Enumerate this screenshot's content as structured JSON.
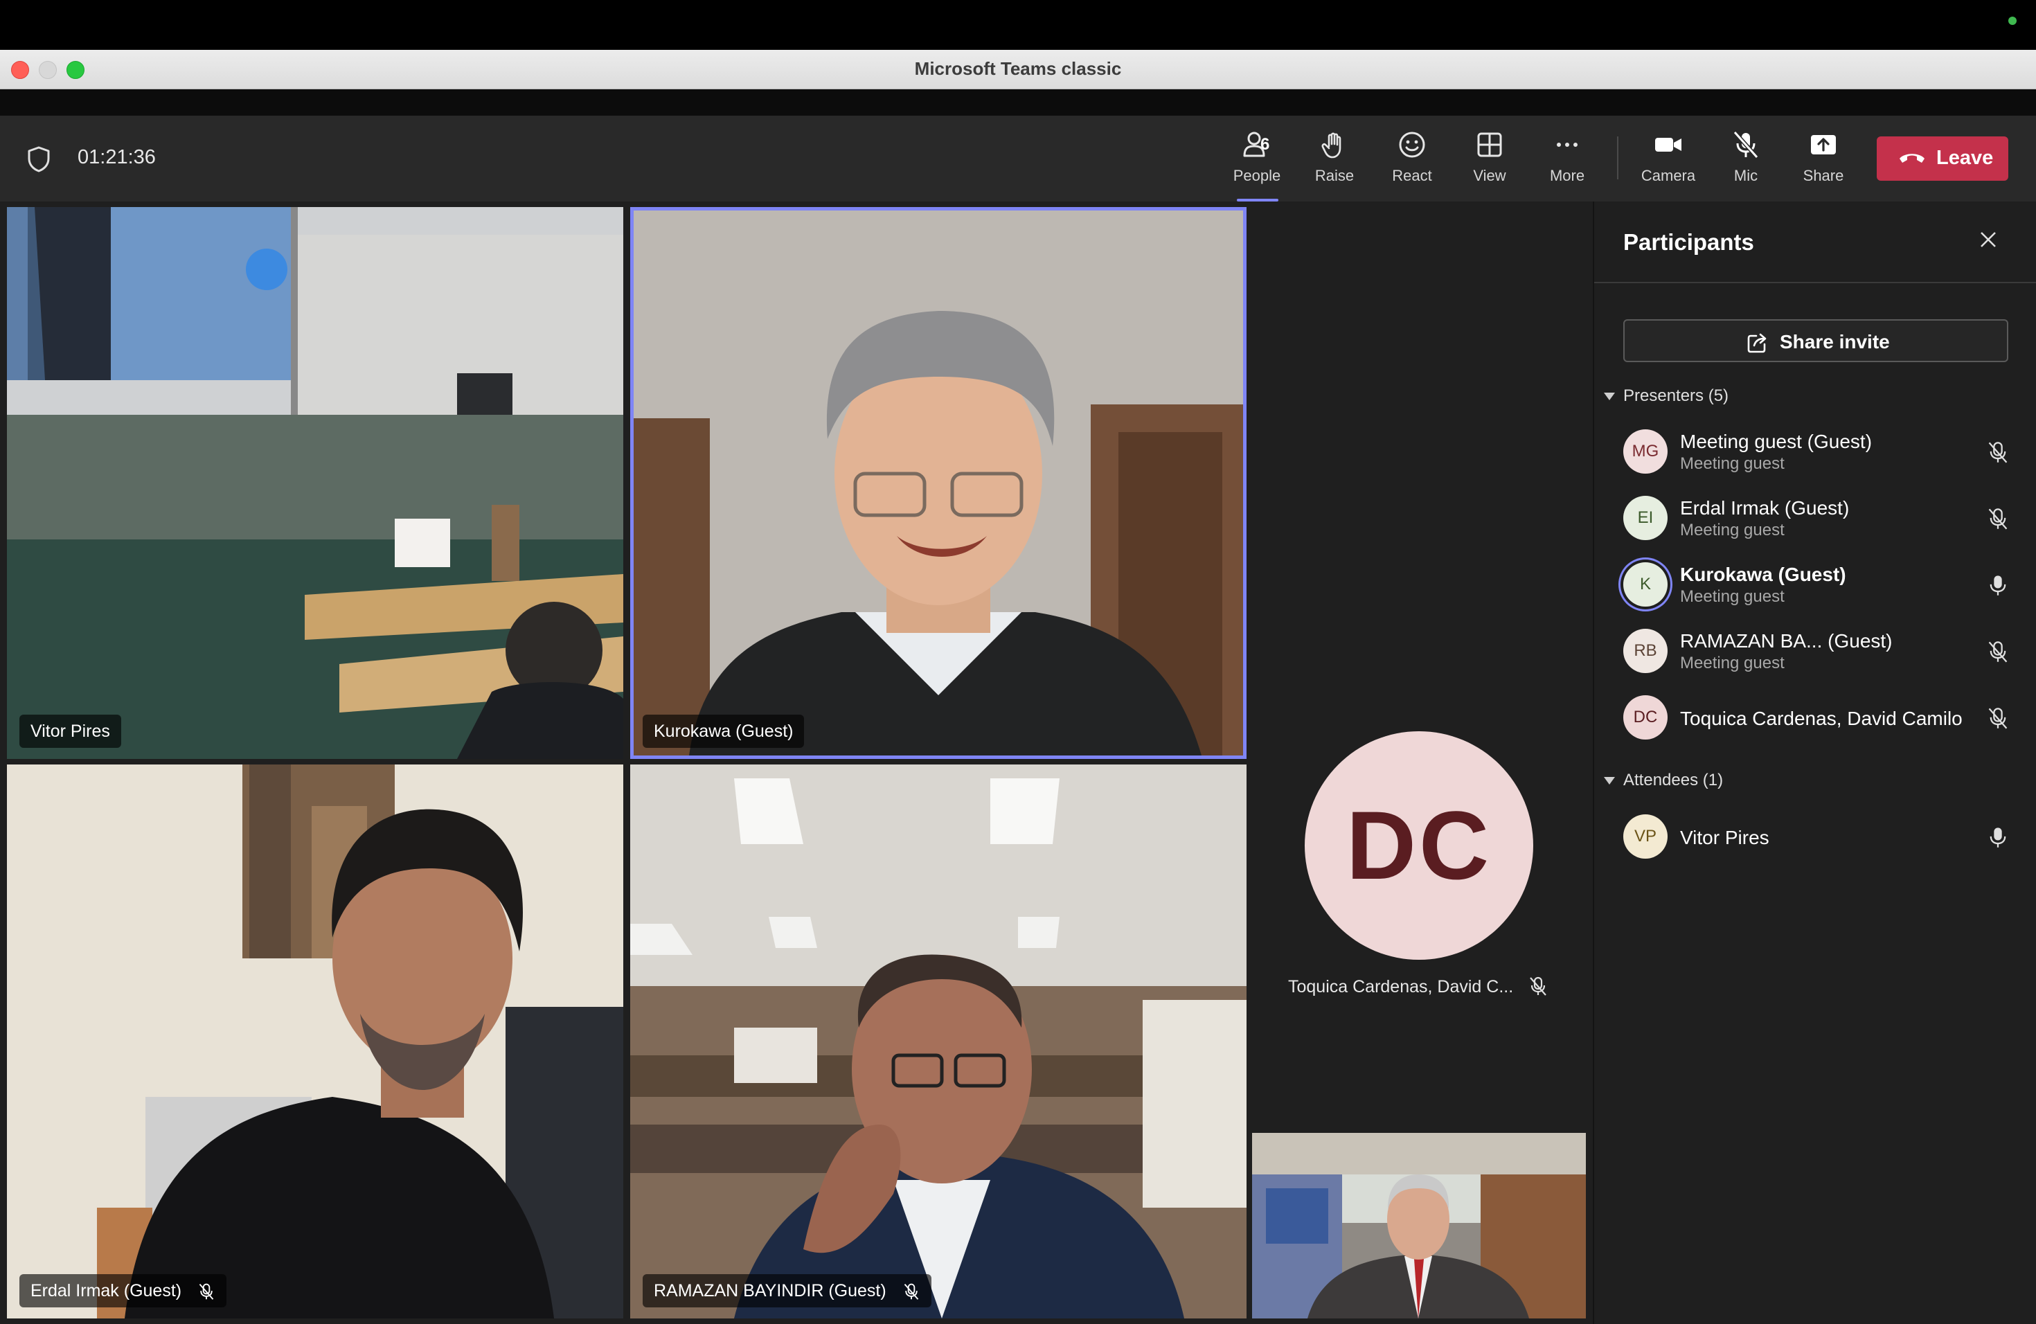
{
  "window": {
    "title": "Microsoft Teams classic"
  },
  "toolbar": {
    "timer": "01:21:36",
    "people_count": "6",
    "buttons": {
      "people": "People",
      "raise": "Raise",
      "react": "React",
      "view": "View",
      "more": "More",
      "camera": "Camera",
      "mic": "Mic",
      "share": "Share"
    },
    "leave": "Leave",
    "accent": "#7f85f5",
    "leave_color": "#c4314b"
  },
  "tiles": {
    "vitor": "Vitor Pires",
    "kurokawa": "Kurokawa (Guest)",
    "erdal": "Erdal Irmak (Guest)",
    "ramazan": "RAMAZAN BAYINDIR (Guest)",
    "dc_initials": "DC",
    "dc_name": "Toquica Cardenas, David C..."
  },
  "panel": {
    "title": "Participants",
    "share_invite": "Share invite",
    "presenters_label": "Presenters (5)",
    "attendees_label": "Attendees (1)",
    "presenters": [
      {
        "initials": "MG",
        "name": "Meeting guest (Guest)",
        "sub": "Meeting guest",
        "muted": true,
        "avatar_bg": "#f1dede",
        "avatar_fg": "#7a2b30"
      },
      {
        "initials": "EI",
        "name": "Erdal Irmak (Guest)",
        "sub": "Meeting guest",
        "muted": true,
        "avatar_bg": "#e6eee0",
        "avatar_fg": "#3b5a2a"
      },
      {
        "initials": "K",
        "name": "Kurokawa (Guest)",
        "sub": "Meeting guest",
        "muted": false,
        "avatar_bg": "#e6eee0",
        "avatar_fg": "#3b5a2a"
      },
      {
        "initials": "RB",
        "name": "RAMAZAN BA...  (Guest)",
        "sub": "Meeting guest",
        "muted": true,
        "avatar_bg": "#efe7e2",
        "avatar_fg": "#5c4437"
      },
      {
        "initials": "DC",
        "name": "Toquica Cardenas, David Camilo",
        "sub": "",
        "muted": true,
        "avatar_bg": "#efd7d7",
        "avatar_fg": "#5a1d21"
      }
    ],
    "attendees": [
      {
        "initials": "VP",
        "name": "Vitor Pires",
        "sub": "",
        "muted": false,
        "avatar_bg": "#f3ead2",
        "avatar_fg": "#6b5418"
      }
    ]
  }
}
